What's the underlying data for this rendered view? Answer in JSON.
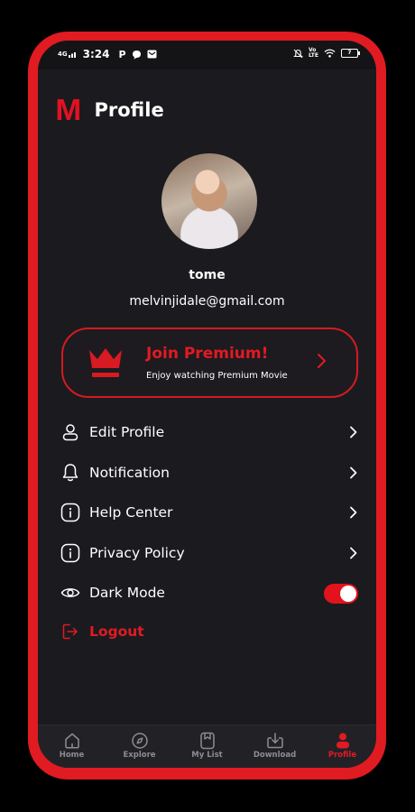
{
  "status_bar": {
    "network": "4G",
    "time": "3:24",
    "left_icons": [
      "p-icon",
      "message-icon",
      "mail-icon"
    ],
    "right_icons": [
      "mute-icon",
      "volte-icon",
      "wifi-icon"
    ],
    "battery": "7"
  },
  "header": {
    "logo": "M",
    "title": "Profile"
  },
  "profile": {
    "name": "tome",
    "email": "melvinjidale@gmail.com"
  },
  "premium": {
    "title": "Join Premium!",
    "subtitle": "Enjoy watching Premium Movie",
    "accent": "#e21a24"
  },
  "menu": [
    {
      "label": "Edit Profile",
      "icon": "user-icon"
    },
    {
      "label": "Notification",
      "icon": "bell-icon"
    },
    {
      "label": "Help Center",
      "icon": "info-icon"
    },
    {
      "label": "Privacy Policy",
      "icon": "info-icon"
    },
    {
      "label": "Dark Mode",
      "icon": "eye-icon",
      "toggle": true
    }
  ],
  "logout": {
    "label": "Logout",
    "icon": "logout-icon"
  },
  "bottom_nav": [
    {
      "label": "Home",
      "icon": "home-icon"
    },
    {
      "label": "Explore",
      "icon": "compass-icon"
    },
    {
      "label": "My List",
      "icon": "bookmark-icon"
    },
    {
      "label": "Download",
      "icon": "download-icon"
    },
    {
      "label": "Profile",
      "icon": "person-icon",
      "active": true
    }
  ]
}
